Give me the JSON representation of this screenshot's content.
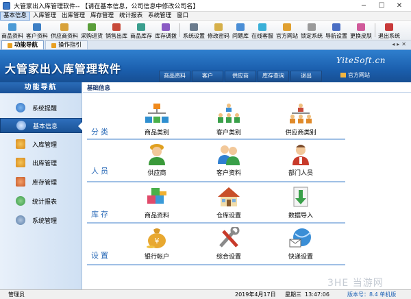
{
  "window": {
    "title": "大管家出入库管理软件-- 【请在基本信息，公司信息中修改公司名】"
  },
  "menu": [
    "基本信息",
    "入库管理",
    "出库管理",
    "库存管理",
    "统计报表",
    "系统管理",
    "窗口"
  ],
  "toolbar": [
    "商品资料",
    "客户资料",
    "供应商资料",
    "采购进货",
    "销售出库",
    "商品库存",
    "库存调拨",
    "系统设置",
    "修改密码",
    "问题库",
    "在线客服",
    "官方网站",
    "锁定系统",
    "导航设置",
    "更换皮肤",
    "退出系统"
  ],
  "tabs": [
    "功能导航",
    "操作指引"
  ],
  "banner": {
    "title": "大管家出入库管理软件",
    "brand": "YiteSoft.cn",
    "site": "官方网站",
    "nav": [
      "商品资料",
      "客户",
      "供应商",
      "库存查询",
      "退出"
    ]
  },
  "sidebar": {
    "header": "功能导航",
    "items": [
      "系统提醒",
      "基本信息",
      "入库管理",
      "出库管理",
      "库存管理",
      "统计报表",
      "系统管理"
    ]
  },
  "main": {
    "breadcrumb": "基础信息",
    "categories": [
      "分类",
      "人员",
      "库存",
      "设置"
    ],
    "items": [
      [
        "商品类别",
        "客户类别",
        "供应商类别"
      ],
      [
        "供应商",
        "客户资料",
        "部门人员"
      ],
      [
        "商品资料",
        "仓库设置",
        "数据导入"
      ],
      [
        "银行帐户",
        "综合设置",
        "快递设置"
      ]
    ]
  },
  "status": {
    "user": "管理员",
    "date": "2019年4月17日",
    "weekday": "星期三",
    "time": "13:47:06",
    "version": "版本号：8.4 单机版"
  },
  "watermark": "3HE 当游网"
}
